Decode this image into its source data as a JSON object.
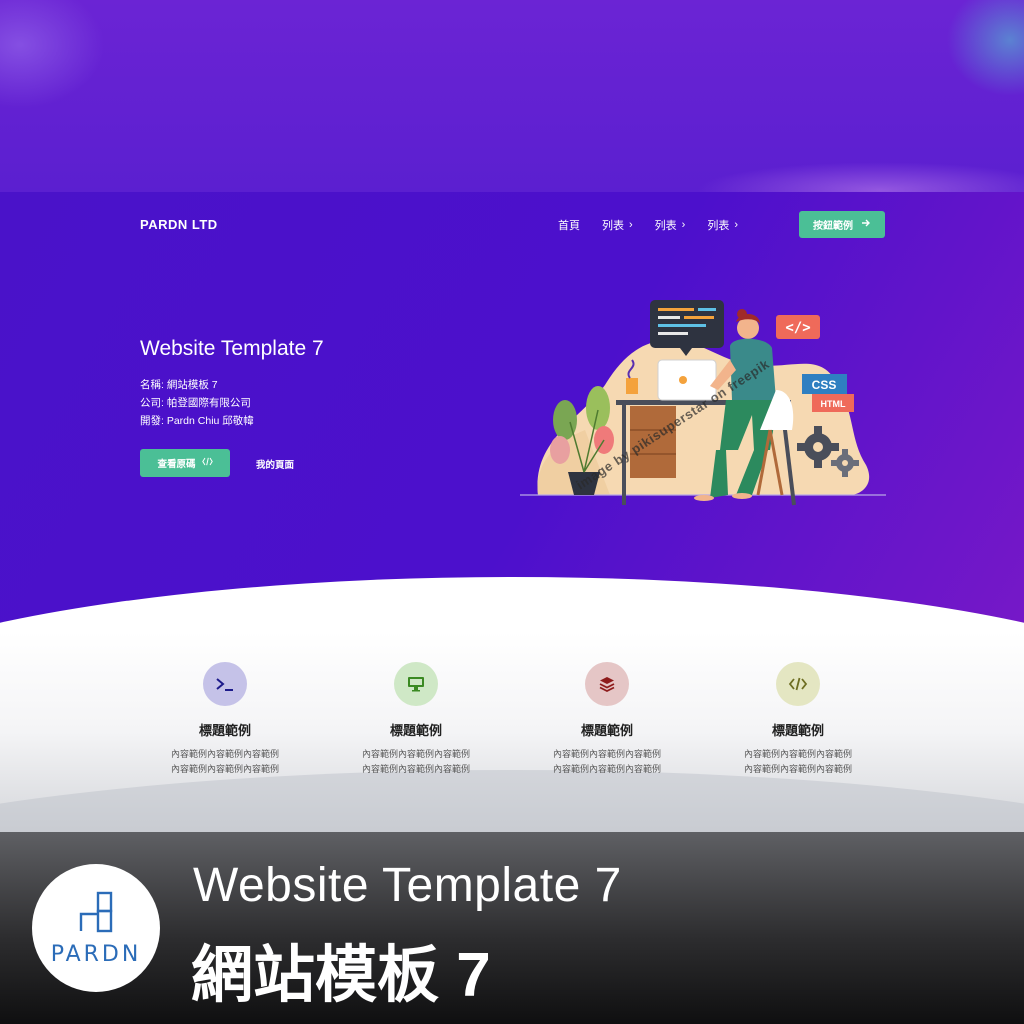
{
  "header": {
    "logo": "PARDN LTD",
    "nav": [
      {
        "label": "首頁",
        "has_chevron": false
      },
      {
        "label": "列表",
        "has_chevron": true
      },
      {
        "label": "列表",
        "has_chevron": true
      },
      {
        "label": "列表",
        "has_chevron": true
      }
    ],
    "cta_label": "按鈕範例",
    "cta_icon": "arrow-right-icon"
  },
  "hero": {
    "title": "Website Template 7",
    "meta": [
      "名稱: 網站模板 7",
      "公司: 帕登國際有限公司",
      "開發: Pardn Chiu 邱敬幃"
    ],
    "primary_button": "查看原碼",
    "primary_icon": "code-icon",
    "secondary_button": "我的頁面",
    "illustration": {
      "code_tag": "</>",
      "css_label": "CSS",
      "html_label": "HTML",
      "watermark": "image by pikisuperstar on freepik"
    }
  },
  "features": [
    {
      "icon": "terminal-icon",
      "title": "標題範例",
      "desc": [
        "內容範例內容範例內容範例",
        "內容範例內容範例內容範例"
      ],
      "bg": "#c5c2e8",
      "fg": "#2a2aa0"
    },
    {
      "icon": "monitor-icon",
      "title": "標題範例",
      "desc": [
        "內容範例內容範例內容範例",
        "內容範例內容範例內容範例"
      ],
      "bg": "#cfe8c6",
      "fg": "#3a9a2a"
    },
    {
      "icon": "layers-icon",
      "title": "標題範例",
      "desc": [
        "內容範例內容範例內容範例",
        "內容範例內容範例內容範例"
      ],
      "bg": "#e5c6c6",
      "fg": "#9a2424"
    },
    {
      "icon": "code-icon",
      "title": "標題範例",
      "desc": [
        "內容範例內容範例內容範例",
        "內容範例內容範例內容範例"
      ],
      "bg": "#e4e6c2",
      "fg": "#7a7a2a"
    }
  ],
  "footer": {
    "brand": "PARDN",
    "title_en": "Website Template 7",
    "title_zh": "網站模板 7"
  },
  "colors": {
    "hero_bg": "#4b12c9",
    "accent": "#4bbf96",
    "brand_blue": "#2b6cb8"
  }
}
